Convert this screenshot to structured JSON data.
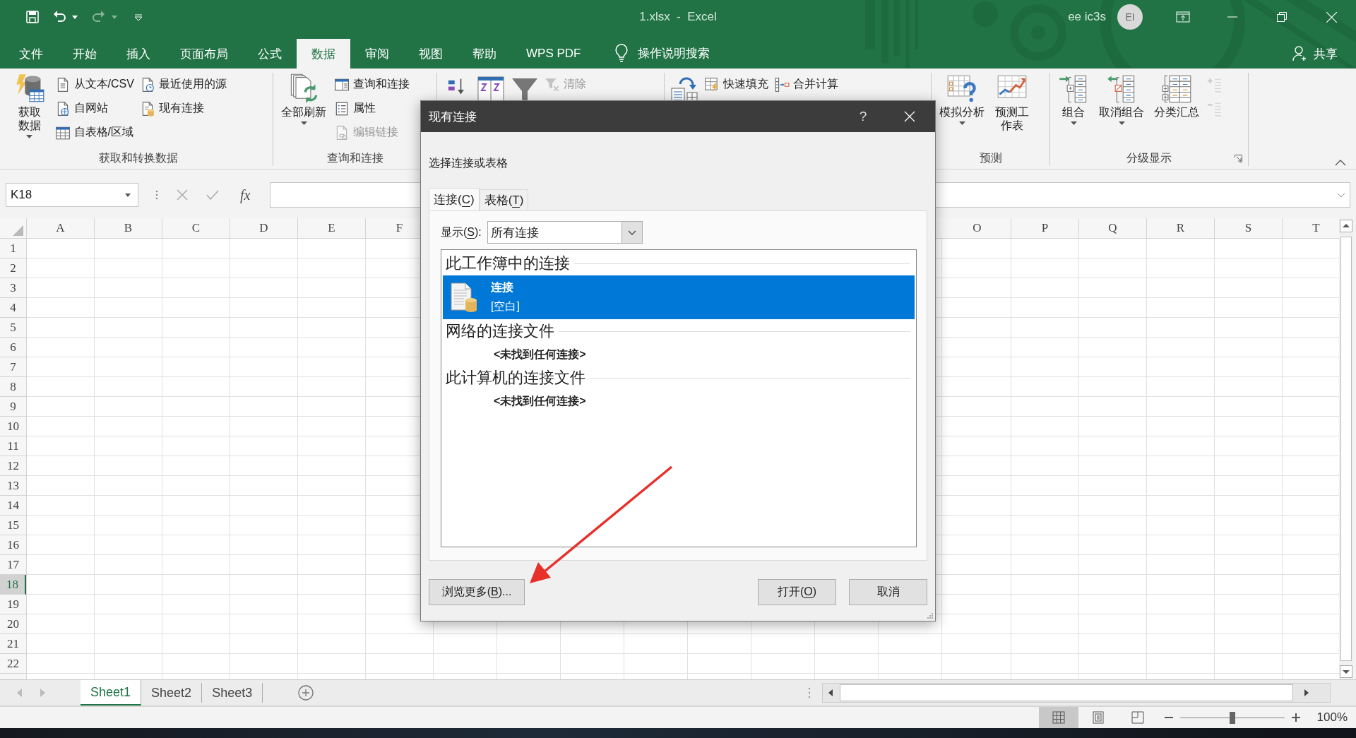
{
  "window": {
    "title": "1.xlsx  -  Excel",
    "user": "ee ic3s",
    "avatar": "EI"
  },
  "quick_access": [
    {
      "kind": "save",
      "disabled": false
    },
    {
      "kind": "undo",
      "disabled": false
    },
    {
      "kind": "redo",
      "disabled": true
    },
    {
      "kind": "customize",
      "disabled": false
    }
  ],
  "tabs": [
    {
      "label": "文件",
      "selected": false
    },
    {
      "label": "开始",
      "selected": false
    },
    {
      "label": "插入",
      "selected": false
    },
    {
      "label": "页面布局",
      "selected": false
    },
    {
      "label": "公式",
      "selected": false
    },
    {
      "label": "数据",
      "selected": true
    },
    {
      "label": "审阅",
      "selected": false
    },
    {
      "label": "视图",
      "selected": false
    },
    {
      "label": "帮助",
      "selected": false
    },
    {
      "label": "WPS PDF",
      "selected": false
    }
  ],
  "tell_me": "操作说明搜索",
  "share": "共享",
  "ribbon": {
    "groups": [
      {
        "label": "获取和转换数据",
        "items": [
          {
            "kind": "large",
            "label": "获取数据",
            "dropdown": true
          },
          {
            "kind": "column",
            "items": [
              {
                "label": "从文本/CSV",
                "disabled": false
              },
              {
                "label": "自网站",
                "disabled": false
              },
              {
                "label": "自表格/区域",
                "disabled": false
              }
            ]
          },
          {
            "kind": "column",
            "items": [
              {
                "label": "最近使用的源",
                "disabled": false
              },
              {
                "label": "现有连接",
                "disabled": false
              }
            ]
          }
        ]
      },
      {
        "label": "查询和连接",
        "items": [
          {
            "kind": "large",
            "label": "全部刷新",
            "dropdown": true
          },
          {
            "kind": "column",
            "items": [
              {
                "label": "查询和连接",
                "disabled": false
              },
              {
                "label": "属性",
                "disabled": false
              },
              {
                "label": "编辑链接",
                "disabled": true
              }
            ]
          }
        ]
      },
      {
        "items": [
          {
            "kind": "large-icon"
          },
          {
            "kind": "large-icon"
          },
          {
            "kind": "large-icon"
          },
          {
            "kind": "column",
            "items": [
              {
                "label": "清除",
                "disabled": true
              }
            ]
          }
        ]
      },
      {
        "items": [
          {
            "kind": "large-icon"
          },
          {
            "kind": "column",
            "items": [
              {
                "label": "快速填充",
                "disabled": false
              }
            ]
          },
          {
            "kind": "column",
            "items": [
              {
                "label": "合并计算",
                "disabled": false
              }
            ]
          }
        ]
      },
      {
        "label": "预测",
        "items": [
          {
            "kind": "large",
            "label": "模拟分析",
            "dropdown": true
          },
          {
            "kind": "large",
            "label": "预测工作表",
            "dropdown": false
          }
        ]
      },
      {
        "label": "分级显示",
        "launcher": true,
        "items": [
          {
            "kind": "large",
            "label": "组合",
            "dropdown": true
          },
          {
            "kind": "large",
            "label": "取消组合",
            "dropdown": true
          },
          {
            "kind": "large",
            "label": "分类汇总",
            "dropdown": false
          },
          {
            "kind": "column",
            "items": [
              {
                "disabled": true
              },
              {
                "disabled": true
              }
            ]
          }
        ]
      }
    ]
  },
  "formula_bar": {
    "name_box": "K18",
    "function_label": "fx"
  },
  "sheet": {
    "column_groups": [
      [
        "A",
        "B",
        "C",
        "D",
        "E",
        "F"
      ],
      [
        "O",
        "P",
        "Q",
        "R",
        "S",
        "T"
      ]
    ],
    "rows": [
      {
        "label": "1",
        "selected": false
      },
      {
        "label": "2",
        "selected": false
      },
      {
        "label": "3",
        "selected": false
      },
      {
        "label": "4",
        "selected": false
      },
      {
        "label": "5",
        "selected": false
      },
      {
        "label": "6",
        "selected": false
      },
      {
        "label": "7",
        "selected": false
      },
      {
        "label": "8",
        "selected": false
      },
      {
        "label": "9",
        "selected": false
      },
      {
        "label": "10",
        "selected": false
      },
      {
        "label": "11",
        "selected": false
      },
      {
        "label": "12",
        "selected": false
      },
      {
        "label": "13",
        "selected": false
      },
      {
        "label": "14",
        "selected": false
      },
      {
        "label": "15",
        "selected": false
      },
      {
        "label": "16",
        "selected": false
      },
      {
        "label": "17",
        "selected": false
      },
      {
        "label": "18",
        "selected": true
      },
      {
        "label": "19",
        "selected": false
      },
      {
        "label": "20",
        "selected": false
      },
      {
        "label": "21",
        "selected": false
      },
      {
        "label": "22",
        "selected": false
      }
    ]
  },
  "sheet_tabs": [
    {
      "label": "Sheet1",
      "selected": true
    },
    {
      "label": "Sheet2",
      "selected": false
    },
    {
      "label": "Sheet3",
      "selected": false
    }
  ],
  "status_bar": {
    "views": [
      {
        "kind": "normal",
        "selected": true
      },
      {
        "kind": "page-layout",
        "selected": false
      },
      {
        "kind": "page-break",
        "selected": false
      }
    ],
    "zoom": {
      "level": 0.5,
      "reading": "100%"
    }
  },
  "dialog": {
    "title": "现有连接",
    "help_glyph": "?",
    "prompt": "选择连接或表格",
    "tabs": [
      {
        "parts": [
          {
            "text": "连接(",
            "underline": false
          },
          {
            "text": "C",
            "underline": true
          },
          {
            "text": ")",
            "underline": false
          }
        ],
        "selected": true
      },
      {
        "parts": [
          {
            "text": "表格(",
            "underline": false
          },
          {
            "text": "T",
            "underline": true
          },
          {
            "text": ")",
            "underline": false
          }
        ],
        "selected": false
      }
    ],
    "show": {
      "parts": [
        {
          "text": "显示(",
          "underline": false
        },
        {
          "text": "S",
          "underline": true
        },
        {
          "text": "):",
          "underline": false
        }
      ],
      "value": "所有连接"
    },
    "sections": [
      {
        "heading": "此工作簿中的连接",
        "items": [
          {
            "name": "连接",
            "description": "[空白]",
            "selected": true
          }
        ]
      },
      {
        "heading": "网络的连接文件",
        "empty_message": "<未找到任何连接>"
      },
      {
        "heading": "此计算机的连接文件",
        "empty_message": "<未找到任何连接>"
      }
    ],
    "buttons": [
      {
        "kind": "browse",
        "parts": [
          {
            "text": "浏览更多(",
            "underline": false
          },
          {
            "text": "B",
            "underline": true
          },
          {
            "text": ")...",
            "underline": false
          }
        ]
      },
      {
        "kind": "open",
        "parts": [
          {
            "text": "打开(",
            "underline": false
          },
          {
            "text": "O",
            "underline": true
          },
          {
            "text": ")",
            "underline": false
          }
        ]
      },
      {
        "kind": "cancel",
        "parts": [
          {
            "text": "取消",
            "underline": false
          }
        ]
      }
    ]
  }
}
